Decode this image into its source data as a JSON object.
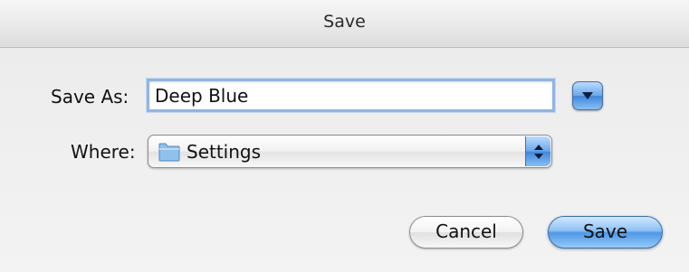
{
  "window": {
    "title": "Save"
  },
  "form": {
    "save_as_label": "Save As:",
    "save_as_value": "Deep Blue",
    "where_label": "Where:",
    "where_value": "Settings"
  },
  "buttons": {
    "cancel": "Cancel",
    "save": "Save"
  },
  "colors": {
    "accent": "#4f97e6",
    "focus_ring": "#92b5df"
  },
  "icons": {
    "disclosure": "triangle-down-icon",
    "folder": "folder-icon",
    "popup_arrows": "up-down-arrows-icon"
  }
}
